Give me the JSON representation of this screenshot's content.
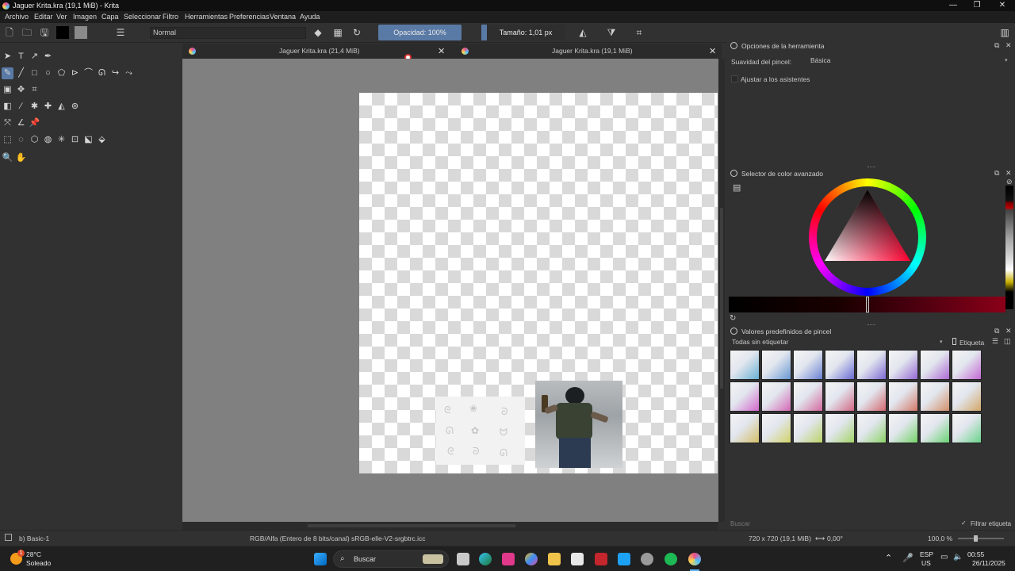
{
  "window": {
    "title": "Jaguer Krita.kra (19,1 MiB)  - Krita"
  },
  "menu": [
    "Archivo",
    "Editar",
    "Ver",
    "Imagen",
    "Capa",
    "Seleccionar",
    "Filtro",
    "Herramientas",
    "Preferencias",
    "Ventana",
    "Ayuda"
  ],
  "toolbar": {
    "blend_mode": "Normal",
    "opacity_label": "Opacidad: 100%",
    "size_label": "Tamaño: 1,01 px",
    "opacity_value": 100
  },
  "tabs": [
    {
      "label": "Jaguer Krita.kra (21,4 MiB)"
    },
    {
      "label": "Jaguer Krita.kra (19,1 MiB)"
    }
  ],
  "tool_options": {
    "title": "Opciones de la herramienta",
    "smoothing_label": "Suavidad del pincel:",
    "smoothing_value": "Básica",
    "assistants_label": "Ajustar a los asistentes",
    "assistants_checked": false
  },
  "color_selector": {
    "title": "Selector de color avanzado"
  },
  "brush_presets": {
    "title": "Valores predefinidos de pincel",
    "tag_filter": "Todas sin etiquetar",
    "tag_label": "Etiqueta",
    "search_placeholder": "Buscar",
    "filter_tag_label": "Filtrar etiqueta",
    "filter_tag_checked": true,
    "count": 24
  },
  "status": {
    "preset": "b) Basic-1",
    "colorspace": "RGB/Alfa (Entero de 8 bits/canal)  sRGB-elle-V2-srgbtrc.icc",
    "dimensions": "720 x 720 (19,1 MiB)",
    "rotation": "0,00°",
    "zoom": "100,0 %"
  },
  "taskbar": {
    "temp": "28°C",
    "weather": "Soleado",
    "weather_badge": "1",
    "search": "Buscar",
    "lang1": "ESP",
    "lang2": "US",
    "time": "00:55",
    "date": "26/11/2025"
  }
}
